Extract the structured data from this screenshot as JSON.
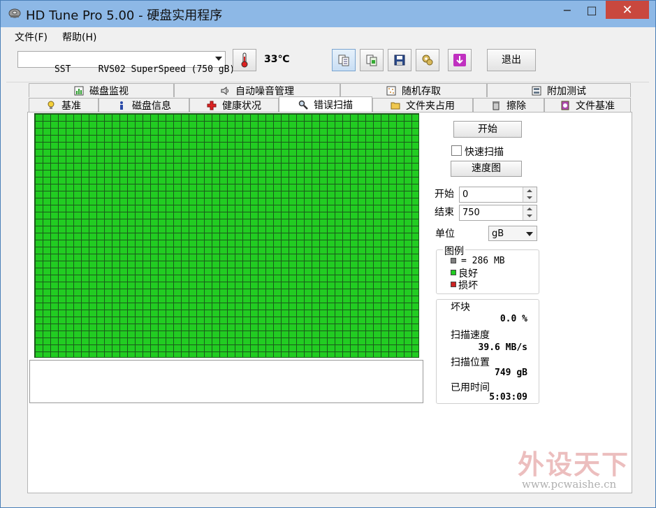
{
  "window": {
    "title": "HD Tune Pro 5.00 - 硬盘实用程序",
    "controls": {
      "minimize": "−",
      "maximize": "□",
      "close": "✕"
    }
  },
  "menu": [
    {
      "label": "文件(F)"
    },
    {
      "label": "帮助(H)"
    }
  ],
  "toolbar": {
    "drive": "SST     RVS02 SuperSpeed (750 gB)",
    "temperature": "33℃",
    "exit_label": "退出",
    "icons": [
      "thermometer-icon",
      "copy-text-icon",
      "copy-screenshot-icon",
      "save-icon",
      "options-icon",
      "download-update-icon"
    ]
  },
  "tabs": {
    "top_row": [
      {
        "label": "磁盘监视",
        "icon": "monitor-chart-icon"
      },
      {
        "label": "自动噪音管理",
        "icon": "speaker-icon"
      },
      {
        "label": "随机存取",
        "icon": "random-access-icon"
      },
      {
        "label": "附加测试",
        "icon": "extra-tests-icon"
      }
    ],
    "bottom_row": [
      {
        "label": "基准",
        "icon": "benchmark-bulb-icon"
      },
      {
        "label": "磁盘信息",
        "icon": "info-icon"
      },
      {
        "label": "健康状况",
        "icon": "health-cross-icon"
      },
      {
        "label": "错误扫描",
        "icon": "magnifier-icon",
        "selected": true
      },
      {
        "label": "文件夹占用",
        "icon": "folder-icon"
      },
      {
        "label": "擦除",
        "icon": "trash-icon"
      },
      {
        "label": "文件基准",
        "icon": "file-benchmark-icon"
      }
    ]
  },
  "scan": {
    "start_button": "开始",
    "quick_scan_label": "快速扫描",
    "quick_scan_checked": false,
    "speed_map_button": "速度图",
    "start_label": "开始",
    "start_value": "0",
    "end_label": "结束",
    "end_value": "750",
    "unit_label": "单位",
    "unit_value": "gB",
    "block_state": "all-good",
    "colors": {
      "good": "#22cc22",
      "damaged": "#cc2222",
      "block": "#808080",
      "grid_line": "#1a5a1a"
    }
  },
  "legend": {
    "title": "图例",
    "block_size": "= 286 MB",
    "good": "良好",
    "damaged": "损坏"
  },
  "stats": {
    "bad_blocks_label": "坏块",
    "bad_blocks_value": "0.0 %",
    "scan_speed_label": "扫描速度",
    "scan_speed_value": "39.6 MB/s",
    "scan_position_label": "扫描位置",
    "scan_position_value": "749 gB",
    "elapsed_label": "已用时间",
    "elapsed_value": "5:03:09"
  },
  "watermark": {
    "logo_text": "外设天下",
    "url": "www.pcwaishe.cn"
  }
}
